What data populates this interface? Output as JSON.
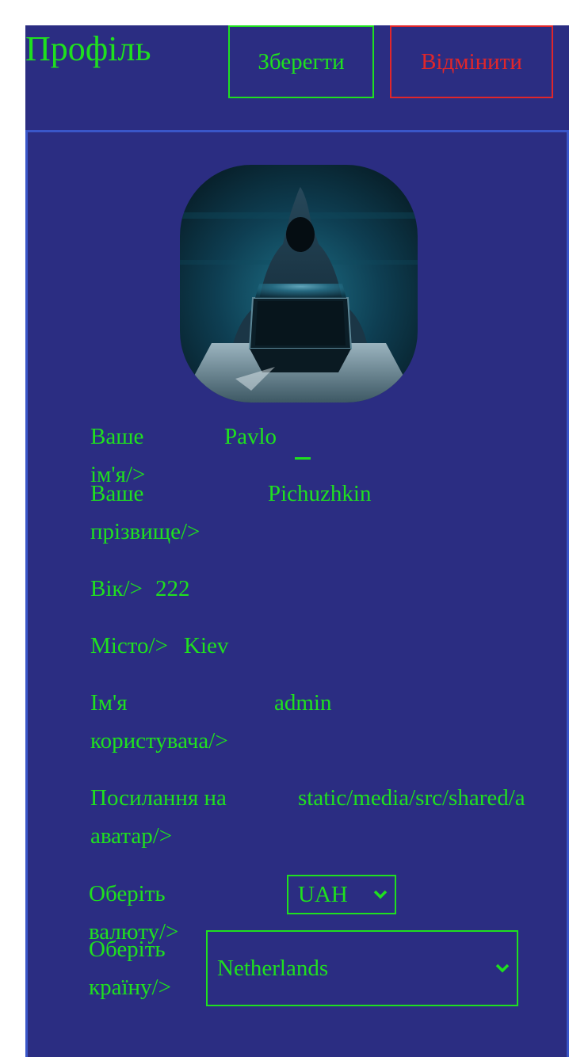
{
  "header": {
    "title": "Профіль",
    "save_label": "Зберегти",
    "cancel_label": "Відмінити"
  },
  "form": {
    "first_name": {
      "label": "Ваше ім'я/>",
      "value": "Pavlo"
    },
    "last_name": {
      "label_line1": "Ваше",
      "label_line2": "прізвище/>",
      "value": "Pichuzhkin"
    },
    "age": {
      "label": "Вік/>",
      "value": "222"
    },
    "city": {
      "label": "Місто/>",
      "value": "Kiev"
    },
    "username": {
      "label_line1": "Ім'я",
      "label_line2": "користувача/>",
      "value": "admin"
    },
    "avatar_link": {
      "label_line1": "Посилання на",
      "label_line2": "аватар/>",
      "value": "static/media/src/shared/a"
    },
    "currency": {
      "label": "Оберіть валюту/>",
      "value": "UAH"
    },
    "country": {
      "label_line1": "Оберіть",
      "label_line2": "країну/>",
      "value": "Netherlands"
    }
  },
  "colors": {
    "background": "#2b2d82",
    "text_accent": "#1fe01f",
    "cancel": "#e0262a",
    "panel_border": "#3a56c8"
  },
  "icons": {
    "avatar": "hooded-hacker-avatar-icon",
    "select_arrow": "chevron-down-icon"
  }
}
